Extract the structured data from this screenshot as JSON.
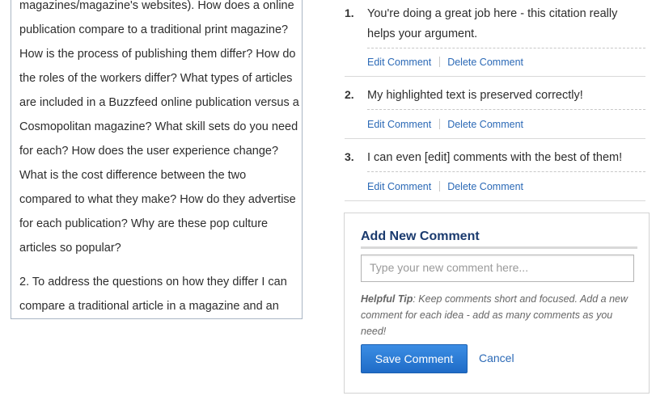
{
  "document": {
    "lines": [
      "magazines/magazine's websites). How does a online",
      "publication compare to a traditional print magazine?",
      "How is the process of publishing them differ? How do",
      "the roles of the workers differ? What types of articles",
      "are included in a Buzzfeed online publication versus a",
      "Cosmopolitan magazine? What skill sets do you need",
      "for each? How does the user experience change?",
      "What is the cost difference between the two",
      "compared to what they make? How do they advertise",
      "for each publication? Why are these pop culture",
      "articles so popular?"
    ],
    "paragraph2_lines": [
      "2. To address the questions on how they differ I can",
      "compare a traditional article in a magazine and an"
    ]
  },
  "comments": [
    {
      "number": "1.",
      "text": "You're doing a great job here - this citation really helps your argument.",
      "edit_label": "Edit Comment",
      "delete_label": "Delete Comment"
    },
    {
      "number": "2.",
      "text": "My highlighted text is preserved correctly!",
      "edit_label": "Edit Comment",
      "delete_label": "Delete Comment"
    },
    {
      "number": "3.",
      "text": "I can even [edit] comments with the best of them!",
      "edit_label": "Edit Comment",
      "delete_label": "Delete Comment"
    }
  ],
  "add_comment": {
    "title": "Add New Comment",
    "placeholder": "Type your new comment here...",
    "tip_label": "Helpful Tip",
    "tip_text": ": Keep comments short and focused. Add a new comment for each idea - add as many comments as you need!",
    "save_label": "Save Comment",
    "cancel_label": "Cancel"
  },
  "colors": {
    "link": "#2b69b6",
    "title": "#1a3a6e",
    "button": "#2f7ed8"
  }
}
